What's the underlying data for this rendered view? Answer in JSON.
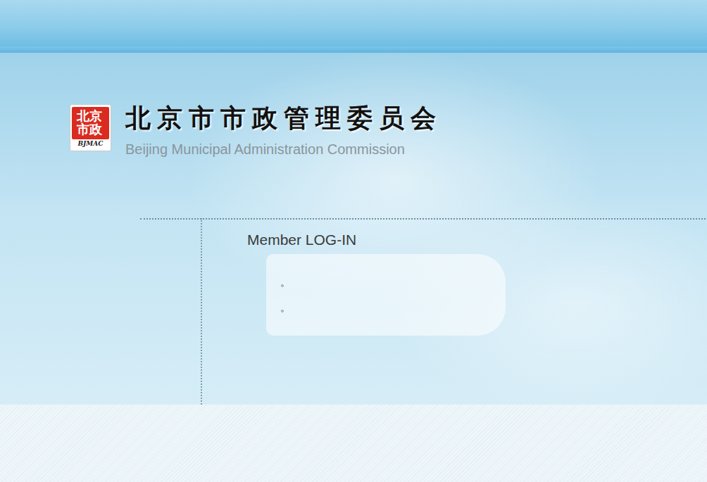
{
  "logo": {
    "seal": "北京市政",
    "caption": "BJMAC"
  },
  "title": "北京市市政管理委员会",
  "subtitle": "Beijing Municipal Administration Commission",
  "login": {
    "heading": "Member LOG-IN",
    "fields": [
      {
        "label": "。"
      },
      {
        "label": "。"
      }
    ]
  }
}
